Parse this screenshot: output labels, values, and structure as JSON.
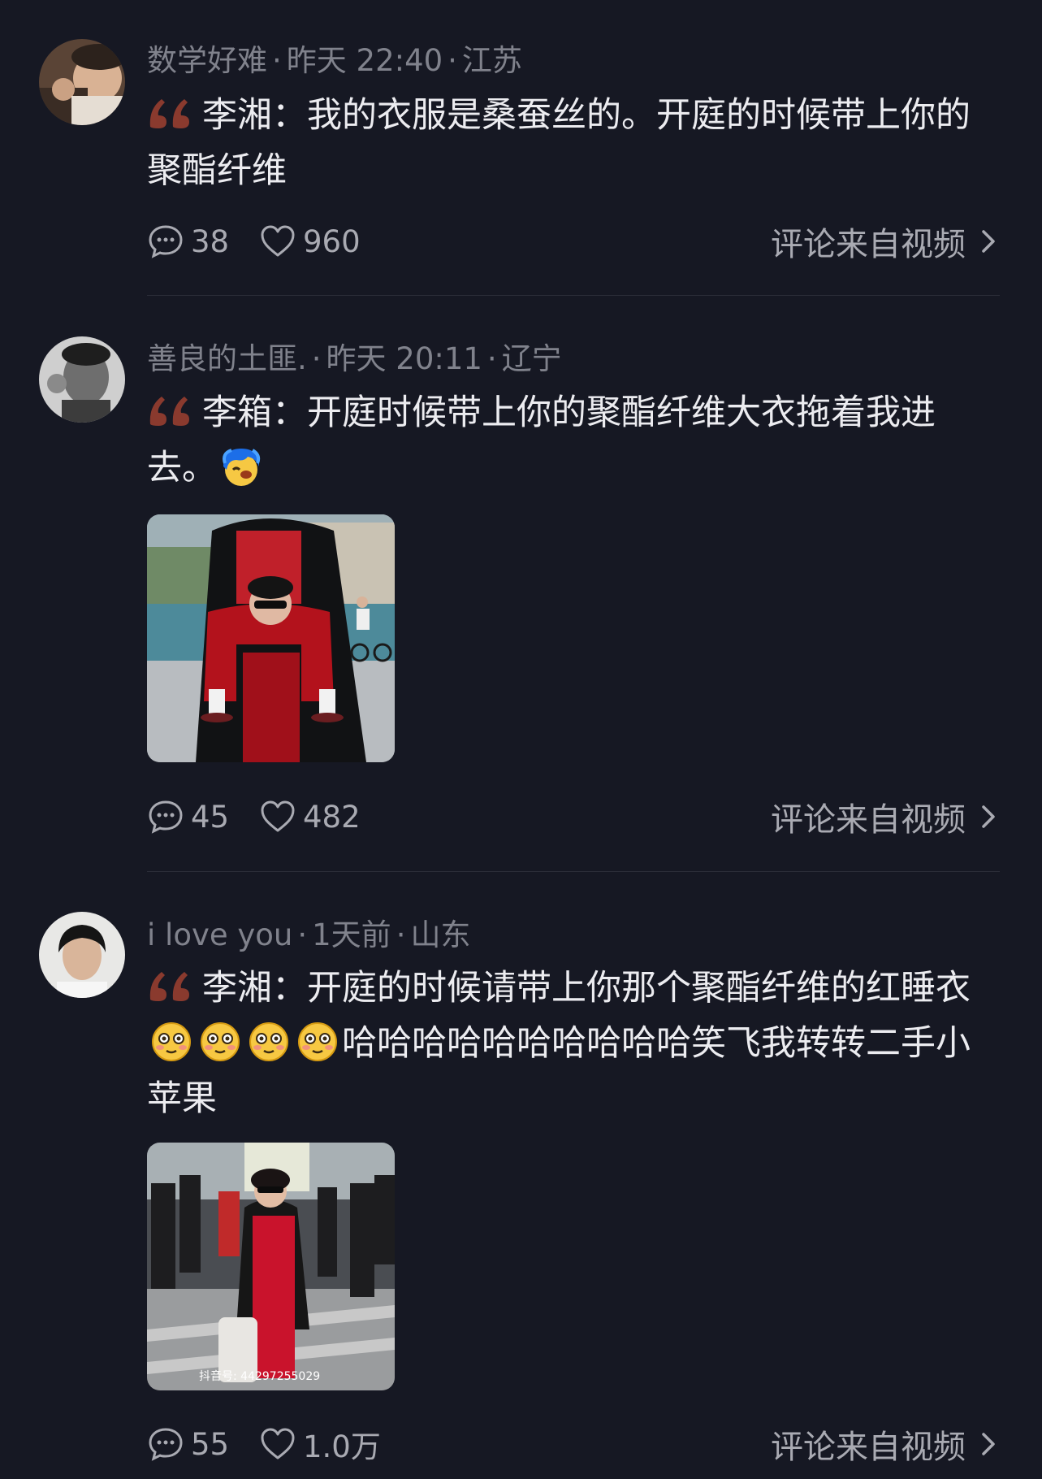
{
  "comments": [
    {
      "username": "数学好难",
      "time": "昨天 22:40",
      "location": "江苏",
      "text": "李湘：我的衣服是桑蚕丝的。开庭的时候带上你的聚酯纤维",
      "reply_count": "38",
      "like_count": "960",
      "source_label": "评论来自视频"
    },
    {
      "username": "善良的土匪.",
      "time": "昨天 20:11",
      "location": "辽宁",
      "text": "李箱：开庭时候带上你的聚酯纤维大衣拖着我进去。",
      "reply_count": "45",
      "like_count": "482",
      "source_label": "评论来自视频"
    },
    {
      "username": "i love you",
      "time": "1天前",
      "location": "山东",
      "text_before_emoji": "李湘：开庭的时候请带上你那个聚酯纤维的红睡衣",
      "text_after_emoji": "哈哈哈哈哈哈哈哈哈哈笑飞我转转二手小苹果",
      "image_watermark": "抖音号: 44297255029",
      "reply_count": "55",
      "like_count": "1.0万",
      "source_label": "评论来自视频"
    }
  ],
  "icons": {
    "reply": "comment-bubble-icon",
    "like": "heart-outline-icon",
    "chevron": "chevron-right-icon",
    "quote": "quote-mark-icon"
  },
  "colors": {
    "background": "#161823",
    "quote_mark": "#8a3a2e",
    "meta_text": "#80828c"
  }
}
